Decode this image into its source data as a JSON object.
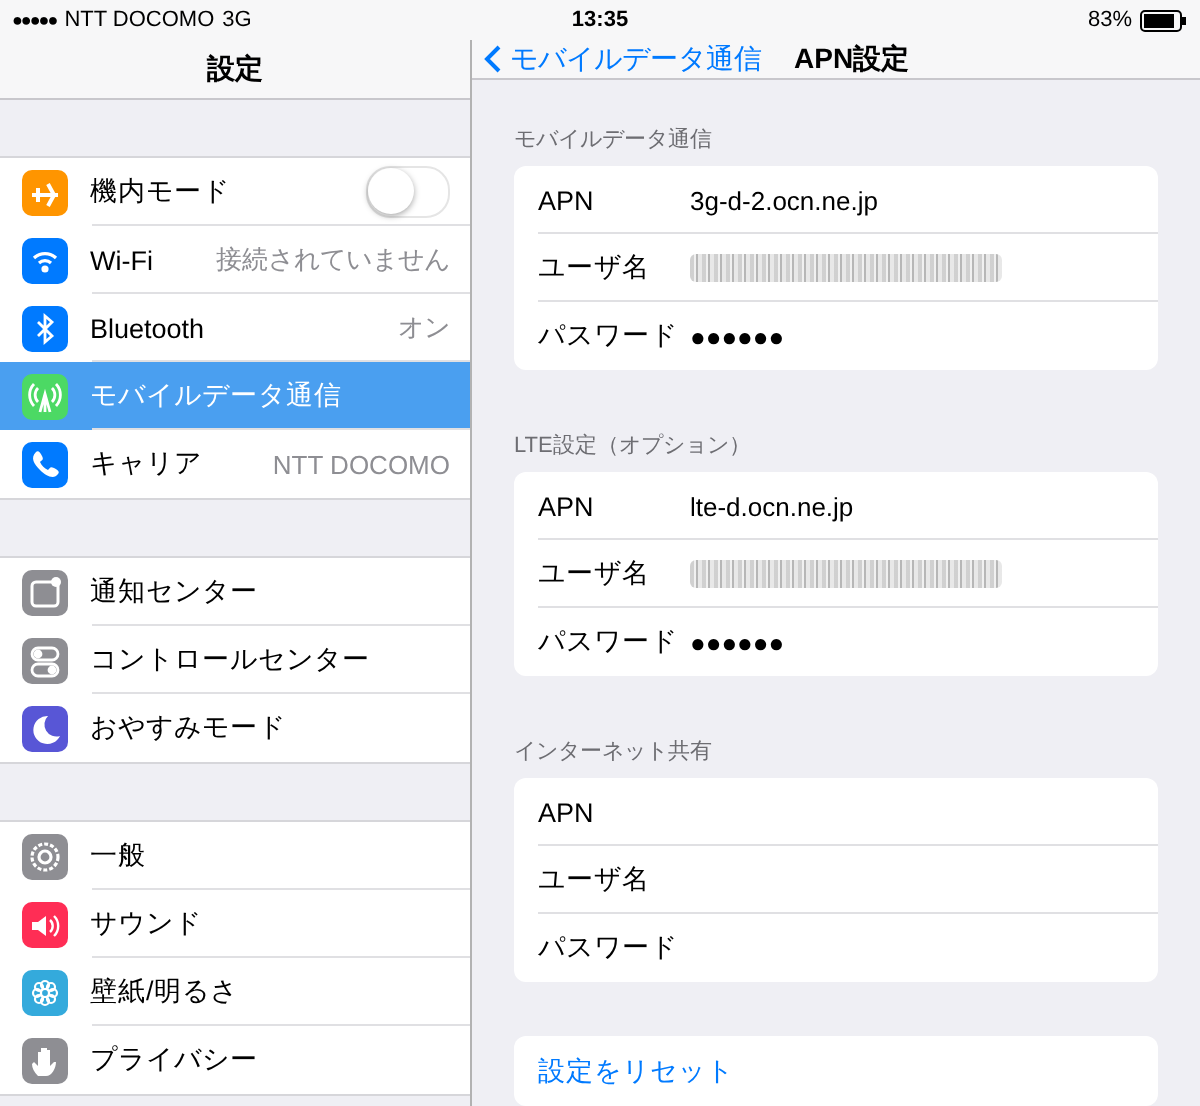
{
  "status_bar": {
    "signal": "●●●●●",
    "carrier": "NTT DOCOMO",
    "network": "3G",
    "time": "13:35",
    "battery": "83%"
  },
  "sidebar": {
    "title": "設定",
    "groups": [
      [
        {
          "label": "機内モード",
          "kind": "toggle",
          "on": false,
          "color": "#ff9500",
          "selected": false
        },
        {
          "label": "Wi-Fi",
          "kind": "value",
          "value": "接続されていません",
          "color": "#007aff",
          "selected": false
        },
        {
          "label": "Bluetooth",
          "kind": "value",
          "value": "オン",
          "color": "#007aff",
          "selected": false
        },
        {
          "label": "モバイルデータ通信",
          "kind": "plain",
          "color": "#4cd964",
          "selected": true
        },
        {
          "label": "キャリア",
          "kind": "value",
          "value": "NTT DOCOMO",
          "color": "#007aff",
          "selected": false
        }
      ],
      [
        {
          "label": "通知センター",
          "kind": "plain",
          "color": "#8e8e93",
          "selected": false
        },
        {
          "label": "コントロールセンター",
          "kind": "plain",
          "color": "#8e8e93",
          "selected": false
        },
        {
          "label": "おやすみモード",
          "kind": "plain",
          "color": "#5856d6",
          "selected": false
        }
      ],
      [
        {
          "label": "一般",
          "kind": "plain",
          "color": "#8e8e93",
          "selected": false
        },
        {
          "label": "サウンド",
          "kind": "plain",
          "color": "#ff2d55",
          "selected": false
        },
        {
          "label": "壁紙/明るさ",
          "kind": "plain",
          "color": "#34aadc",
          "selected": false
        },
        {
          "label": "プライバシー",
          "kind": "plain",
          "color": "#8e8e93",
          "selected": false
        }
      ]
    ]
  },
  "detail": {
    "back": "モバイルデータ通信",
    "title": "APN設定",
    "sections": [
      {
        "header": "モバイルデータ通信",
        "rows": [
          {
            "label": "APN",
            "kind": "text",
            "value": "3g-d-2.ocn.ne.jp"
          },
          {
            "label": "ユーザ名",
            "kind": "obscured"
          },
          {
            "label": "パスワード",
            "kind": "text",
            "value": "●●●●●●"
          }
        ]
      },
      {
        "header": "LTE設定（オプション）",
        "rows": [
          {
            "label": "APN",
            "kind": "text",
            "value": "lte-d.ocn.ne.jp"
          },
          {
            "label": "ユーザ名",
            "kind": "obscured"
          },
          {
            "label": "パスワード",
            "kind": "text",
            "value": "●●●●●●"
          }
        ]
      },
      {
        "header": "インターネット共有",
        "rows": [
          {
            "label": "APN",
            "kind": "empty"
          },
          {
            "label": "ユーザ名",
            "kind": "empty"
          },
          {
            "label": "パスワード",
            "kind": "empty"
          }
        ]
      }
    ],
    "reset": "設定をリセット"
  }
}
